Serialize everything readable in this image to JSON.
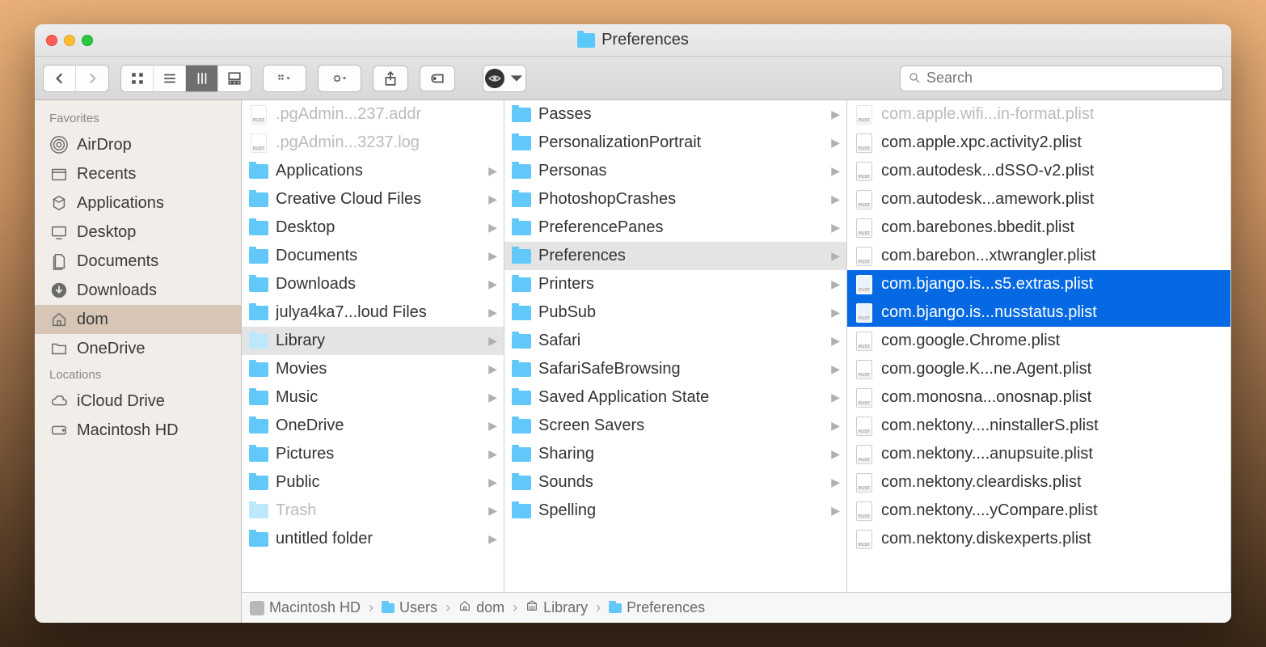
{
  "window": {
    "title": "Preferences"
  },
  "search": {
    "placeholder": "Search"
  },
  "sidebar": {
    "sections": [
      {
        "header": "Favorites",
        "items": [
          {
            "label": "AirDrop",
            "icon": "airdrop"
          },
          {
            "label": "Recents",
            "icon": "recents"
          },
          {
            "label": "Applications",
            "icon": "apps"
          },
          {
            "label": "Desktop",
            "icon": "desktop"
          },
          {
            "label": "Documents",
            "icon": "documents"
          },
          {
            "label": "Downloads",
            "icon": "downloads"
          },
          {
            "label": "dom",
            "icon": "home",
            "active": true
          },
          {
            "label": "OneDrive",
            "icon": "folder"
          }
        ]
      },
      {
        "header": "Locations",
        "items": [
          {
            "label": "iCloud Drive",
            "icon": "cloud"
          },
          {
            "label": "Macintosh HD",
            "icon": "hd"
          }
        ]
      }
    ]
  },
  "columns": [
    [
      {
        "label": ".pgAdmin...237.addr",
        "type": "file",
        "dim": true
      },
      {
        "label": ".pgAdmin...3237.log",
        "type": "file",
        "dim": true
      },
      {
        "label": "Applications",
        "type": "folder",
        "children": true
      },
      {
        "label": "Creative Cloud Files",
        "type": "folder",
        "children": true
      },
      {
        "label": "Desktop",
        "type": "folder",
        "children": true
      },
      {
        "label": "Documents",
        "type": "folder",
        "children": true
      },
      {
        "label": "Downloads",
        "type": "folder",
        "children": true
      },
      {
        "label": "julya4ka7...loud Files",
        "type": "folder",
        "children": true
      },
      {
        "label": "Library",
        "type": "folder",
        "children": true,
        "dim": true,
        "selected": true
      },
      {
        "label": "Movies",
        "type": "folder",
        "children": true
      },
      {
        "label": "Music",
        "type": "folder",
        "children": true
      },
      {
        "label": "OneDrive",
        "type": "folder",
        "children": true
      },
      {
        "label": "Pictures",
        "type": "folder",
        "children": true
      },
      {
        "label": "Public",
        "type": "folder",
        "children": true
      },
      {
        "label": "Trash",
        "type": "folder",
        "children": true,
        "dim": true
      },
      {
        "label": "untitled folder",
        "type": "folder",
        "children": true
      }
    ],
    [
      {
        "label": "Passes",
        "type": "folder",
        "children": true
      },
      {
        "label": "PersonalizationPortrait",
        "type": "folder",
        "children": true
      },
      {
        "label": "Personas",
        "type": "folder",
        "children": true
      },
      {
        "label": "PhotoshopCrashes",
        "type": "folder",
        "children": true
      },
      {
        "label": "PreferencePanes",
        "type": "folder",
        "children": true
      },
      {
        "label": "Preferences",
        "type": "folder",
        "children": true,
        "selected": true
      },
      {
        "label": "Printers",
        "type": "folder",
        "children": true
      },
      {
        "label": "PubSub",
        "type": "folder",
        "children": true
      },
      {
        "label": "Safari",
        "type": "folder",
        "children": true
      },
      {
        "label": "SafariSafeBrowsing",
        "type": "folder",
        "children": true
      },
      {
        "label": "Saved Application State",
        "type": "folder",
        "children": true
      },
      {
        "label": "Screen Savers",
        "type": "folder",
        "children": true
      },
      {
        "label": "Sharing",
        "type": "folder",
        "children": true
      },
      {
        "label": "Sounds",
        "type": "folder",
        "children": true
      },
      {
        "label": "Spelling",
        "type": "folder",
        "children": true
      }
    ],
    [
      {
        "label": "com.apple.wifi...in-format.plist",
        "type": "plist",
        "dim": true,
        "cut": true
      },
      {
        "label": "com.apple.xpc.activity2.plist",
        "type": "plist"
      },
      {
        "label": "com.autodesk...dSSO-v2.plist",
        "type": "plist"
      },
      {
        "label": "com.autodesk...amework.plist",
        "type": "plist"
      },
      {
        "label": "com.barebones.bbedit.plist",
        "type": "plist"
      },
      {
        "label": "com.barebon...xtwrangler.plist",
        "type": "plist"
      },
      {
        "label": "com.bjango.is...s5.extras.plist",
        "type": "plist",
        "selected": true
      },
      {
        "label": "com.bjango.is...nusstatus.plist",
        "type": "plist",
        "selected": true
      },
      {
        "label": "com.google.Chrome.plist",
        "type": "plist"
      },
      {
        "label": "com.google.K...ne.Agent.plist",
        "type": "plist"
      },
      {
        "label": "com.monosna...onosnap.plist",
        "type": "plist"
      },
      {
        "label": "com.nektony....ninstallerS.plist",
        "type": "plist"
      },
      {
        "label": "com.nektony....anupsuite.plist",
        "type": "plist"
      },
      {
        "label": "com.nektony.cleardisks.plist",
        "type": "plist"
      },
      {
        "label": "com.nektony....yCompare.plist",
        "type": "plist"
      },
      {
        "label": "com.nektony.diskexperts.plist",
        "type": "plist"
      }
    ]
  ],
  "pathbar": [
    {
      "label": "Macintosh HD",
      "icon": "hd"
    },
    {
      "label": "Users",
      "icon": "folder"
    },
    {
      "label": "dom",
      "icon": "home"
    },
    {
      "label": "Library",
      "icon": "library"
    },
    {
      "label": "Preferences",
      "icon": "folder"
    }
  ]
}
